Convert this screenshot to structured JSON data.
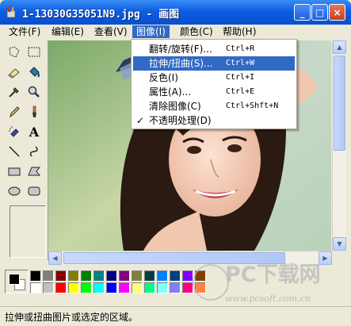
{
  "window": {
    "title": "1-13030G35051N9.jpg - 画图"
  },
  "title_buttons": {
    "minimize": "_",
    "maximize": "□",
    "close": "×"
  },
  "menubar": {
    "items": [
      {
        "label": "文件(F)"
      },
      {
        "label": "编辑(E)"
      },
      {
        "label": "查看(V)"
      },
      {
        "label": "图像(I)"
      },
      {
        "label": "颜色(C)"
      },
      {
        "label": "帮助(H)"
      }
    ]
  },
  "image_menu": {
    "items": [
      {
        "label": "翻转/旋转(F)...",
        "shortcut": "Ctrl+R",
        "checked": ""
      },
      {
        "label": "拉伸/扭曲(S)...",
        "shortcut": "Ctrl+W",
        "checked": ""
      },
      {
        "label": "反色(I)",
        "shortcut": "Ctrl+I",
        "checked": ""
      },
      {
        "label": "属性(A)...",
        "shortcut": "Ctrl+E",
        "checked": ""
      },
      {
        "label": "清除图像(C)",
        "shortcut": "Ctrl+Shft+N",
        "checked": ""
      },
      {
        "label": "不透明处理(D)",
        "shortcut": "",
        "checked": "✓"
      }
    ],
    "highlighted_index": 1
  },
  "tools": [
    {
      "icon": "free-select-icon"
    },
    {
      "icon": "rect-select-icon"
    },
    {
      "icon": "eraser-icon"
    },
    {
      "icon": "fill-icon"
    },
    {
      "icon": "color-picker-icon"
    },
    {
      "icon": "magnifier-icon"
    },
    {
      "icon": "pencil-icon"
    },
    {
      "icon": "brush-icon"
    },
    {
      "icon": "airbrush-icon"
    },
    {
      "icon": "text-icon",
      "glyph": "A"
    },
    {
      "icon": "line-icon"
    },
    {
      "icon": "curve-icon"
    },
    {
      "icon": "rectangle-icon"
    },
    {
      "icon": "polygon-icon"
    },
    {
      "icon": "ellipse-icon"
    },
    {
      "icon": "rounded-rect-icon"
    }
  ],
  "palette": {
    "foreground": "#000000",
    "background": "#ffffff",
    "colors_top": [
      "#000000",
      "#808080",
      "#800000",
      "#808000",
      "#008000",
      "#008080",
      "#000080",
      "#800080",
      "#808040",
      "#004040",
      "#0080ff",
      "#004080",
      "#8000ff",
      "#804000"
    ],
    "colors_bottom": [
      "#ffffff",
      "#c0c0c0",
      "#ff0000",
      "#ffff00",
      "#00ff00",
      "#00ffff",
      "#0000ff",
      "#ff00ff",
      "#ffff80",
      "#00ff80",
      "#80ffff",
      "#8080ff",
      "#ff0080",
      "#ff8040"
    ]
  },
  "status": {
    "text": "拉伸或扭曲图片或选定的区域。"
  },
  "watermark": {
    "text": "PC下载网",
    "url": "www.pcsoft.com.cn"
  },
  "colors": {
    "menu_highlight": "#316ac5",
    "titlebar": "#0d5ee2"
  }
}
